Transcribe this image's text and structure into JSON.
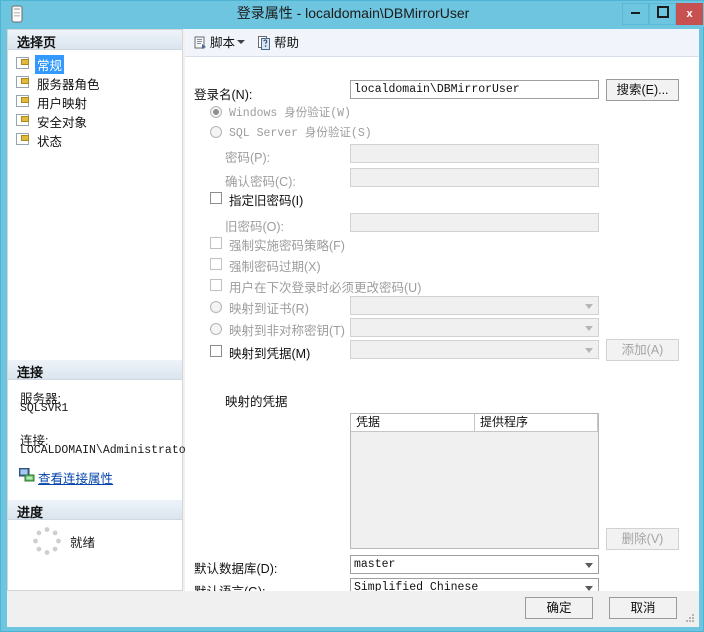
{
  "window": {
    "title": "登录属性 - localdomain\\DBMirrorUser",
    "icon": "login-properties-icon",
    "minimize_label": "",
    "maximize_label": "",
    "close_label": "x",
    "accent_color": "#6ec5e0",
    "close_color": "#c75050"
  },
  "sidebar": {
    "select_page_header": "选择页",
    "pages": [
      {
        "label": "常规",
        "icon": "page-icon",
        "selected": true
      },
      {
        "label": "服务器角色",
        "icon": "page-icon",
        "selected": false
      },
      {
        "label": "用户映射",
        "icon": "page-icon",
        "selected": false
      },
      {
        "label": "安全对象",
        "icon": "page-icon",
        "selected": false
      },
      {
        "label": "状态",
        "icon": "page-icon",
        "selected": false
      }
    ],
    "connection_header": "连接",
    "server_label": "服务器:",
    "server_value": "SQLSVR1",
    "connection_label": "连接:",
    "connection_value": "LOCALDOMAIN\\Administrator",
    "view_connection_properties": "查看连接属性",
    "view_connection_properties_icon": "connection-properties-icon",
    "progress_header": "进度",
    "progress_status": "就绪",
    "progress_icon": "spinner-icon"
  },
  "toolbar": {
    "script_label": "脚本",
    "script_icon": "script-icon",
    "script_dropdown_icon": "chevron-down-icon",
    "help_label": "帮助",
    "help_icon": "help-icon"
  },
  "form": {
    "login_name_label": "登录名(N):",
    "login_name_value": "localdomain\\DBMirrorUser",
    "search_button": "搜索(E)...",
    "windows_auth_label": "Windows 身份验证(W)",
    "windows_auth_checked": true,
    "sql_auth_label": "SQL Server 身份验证(S)",
    "sql_auth_checked": false,
    "password_label": "密码(P):",
    "password_value": "",
    "confirm_password_label": "确认密码(C):",
    "confirm_password_value": "",
    "specify_old_password_label": "指定旧密码(I)",
    "specify_old_password_checked": false,
    "old_password_label": "旧密码(O):",
    "old_password_value": "",
    "enforce_policy_label": "强制实施密码策略(F)",
    "enforce_policy_checked": false,
    "enforce_expiration_label": "强制密码过期(X)",
    "enforce_expiration_checked": false,
    "must_change_label": "用户在下次登录时必须更改密码(U)",
    "must_change_checked": false,
    "map_certificate_label": "映射到证书(R)",
    "map_certificate_checked": false,
    "map_certificate_value": "",
    "map_asymkey_label": "映射到非对称密钥(T)",
    "map_asymkey_checked": false,
    "map_asymkey_value": "",
    "map_credential_label": "映射到凭据(M)",
    "map_credential_checked": false,
    "map_credential_value": "",
    "add_button": "添加(A)",
    "mapped_credentials_label": "映射的凭据",
    "credentials_columns": [
      "凭据",
      "提供程序"
    ],
    "credentials_rows": [],
    "remove_button": "删除(V)",
    "default_database_label": "默认数据库(D):",
    "default_database_value": "master",
    "default_language_label": "默认语言(G):",
    "default_language_value": "Simplified Chinese"
  },
  "footer": {
    "ok_button": "确定",
    "cancel_button": "取消",
    "resize_grip_icon": "resize-grip-icon"
  }
}
